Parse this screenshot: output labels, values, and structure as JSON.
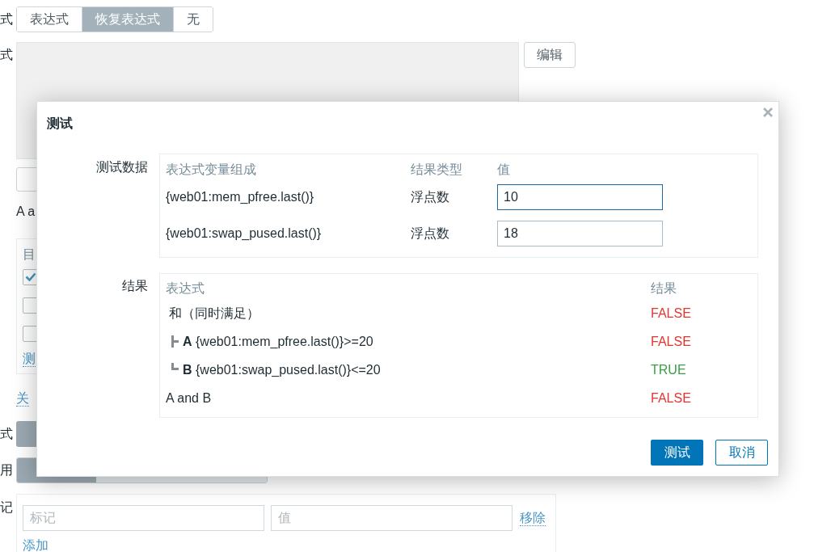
{
  "page": {
    "recovery_mode": {
      "label": "式",
      "options": [
        {
          "label": "表达式",
          "selected": false
        },
        {
          "label": "恢复表达式",
          "selected": true
        },
        {
          "label": "无",
          "selected": false
        }
      ]
    },
    "recovery_expression": {
      "label": "式",
      "edit_button": "编辑"
    },
    "note": "A a",
    "constructor": {
      "header": "目",
      "rows": [
        {
          "checked": true
        },
        {
          "checked": false
        },
        {
          "checked": false
        }
      ],
      "link": "测"
    },
    "close_link": "关",
    "mode_field": {
      "label": "式",
      "options": [
        {
          "selected": true
        }
      ]
    },
    "enabled_field": {
      "label": "用",
      "options": [
        {
          "selected": true
        },
        {
          "selected": false
        }
      ]
    },
    "tags": {
      "label": "记",
      "rows": [
        {
          "tag_placeholder": "标记",
          "value_placeholder": "值",
          "remove_link": "移除"
        }
      ],
      "add_link": "添加"
    }
  },
  "dialog": {
    "title": "测试",
    "test_data": {
      "label": "测试数据",
      "columns": [
        "表达式变量组成",
        "结果类型",
        "值"
      ],
      "rows": [
        {
          "expression": "{web01:mem_pfree.last()}",
          "type": "浮点数",
          "value": "10",
          "focused": true
        },
        {
          "expression": "{web01:swap_pused.last()}",
          "type": "浮点数",
          "value": "18",
          "focused": false
        }
      ]
    },
    "results": {
      "label": "结果",
      "columns": [
        "表达式",
        "结果"
      ],
      "rows": [
        {
          "expression": "和（同时满足）",
          "result": "FALSE",
          "passed": false,
          "children": [
            {
              "expression": "**A** {web01:mem_pfree.last()}>=20",
              "result": "FALSE",
              "passed": false
            },
            {
              "expression": "**B** {web01:swap_pused.last()}<=20",
              "result": "TRUE",
              "passed": true
            }
          ]
        },
        {
          "expression": "A and B",
          "result": "FALSE",
          "passed": false
        }
      ]
    },
    "buttons": [
      {
        "label": "测试",
        "primary": true
      },
      {
        "label": "取消",
        "primary": false
      }
    ]
  }
}
